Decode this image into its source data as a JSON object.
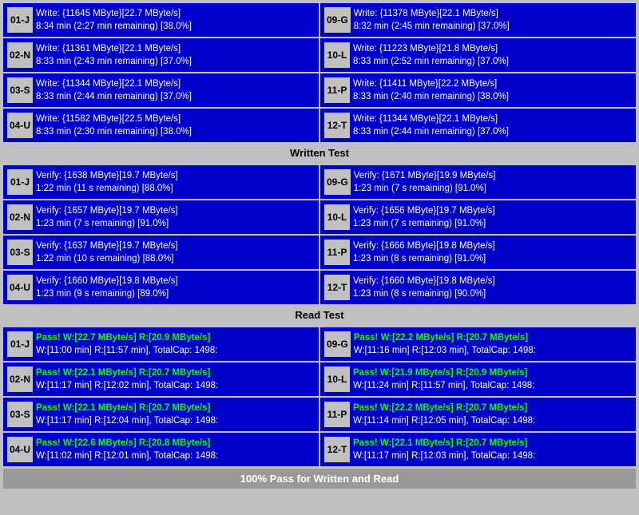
{
  "sections": {
    "write": {
      "rows": [
        {
          "left": {
            "id": "01-J",
            "line1": "Write: {11645 MByte}[22.7 MByte/s]",
            "line2": "8:34 min (2:27 min remaining)  [38.0%]"
          },
          "right": {
            "id": "09-G",
            "line1": "Write: {11378 MByte}[22.1 MByte/s]",
            "line2": "8:32 min (2:45 min remaining)  [37.0%]"
          }
        },
        {
          "left": {
            "id": "02-N",
            "line1": "Write: {11361 MByte}[22.1 MByte/s]",
            "line2": "8:33 min (2:43 min remaining)  [37.0%]"
          },
          "right": {
            "id": "10-L",
            "line1": "Write: {11223 MByte}[21.8 MByte/s]",
            "line2": "8:33 min (2:52 min remaining)  [37.0%]"
          }
        },
        {
          "left": {
            "id": "03-S",
            "line1": "Write: {11344 MByte}[22.1 MByte/s]",
            "line2": "8:33 min (2:44 min remaining)  [37.0%]"
          },
          "right": {
            "id": "11-P",
            "line1": "Write: {11411 MByte}[22.2 MByte/s]",
            "line2": "8:33 min (2:40 min remaining)  [38.0%]"
          }
        },
        {
          "left": {
            "id": "04-U",
            "line1": "Write: {11582 MByte}[22.5 MByte/s]",
            "line2": "8:33 min (2:30 min remaining)  [38.0%]"
          },
          "right": {
            "id": "12-T",
            "line1": "Write: {11344 MByte}[22.1 MByte/s]",
            "line2": "8:33 min (2:44 min remaining)  [37.0%]"
          }
        }
      ],
      "header": "Written Test"
    },
    "verify": {
      "rows": [
        {
          "left": {
            "id": "01-J",
            "line1": "Verify: {1638 MByte}[19.7 MByte/s]",
            "line2": "1:22 min (11 s remaining)   [88.0%]"
          },
          "right": {
            "id": "09-G",
            "line1": "Verify: {1671 MByte}[19.9 MByte/s]",
            "line2": "1:23 min (7 s remaining)   [91.0%]"
          }
        },
        {
          "left": {
            "id": "02-N",
            "line1": "Verify: {1657 MByte}[19.7 MByte/s]",
            "line2": "1:23 min (7 s remaining)   [91.0%]"
          },
          "right": {
            "id": "10-L",
            "line1": "Verify: {1656 MByte}[19.7 MByte/s]",
            "line2": "1:23 min (7 s remaining)   [91.0%]"
          }
        },
        {
          "left": {
            "id": "03-S",
            "line1": "Verify: {1637 MByte}[19.7 MByte/s]",
            "line2": "1:22 min (10 s remaining)   [88.0%]"
          },
          "right": {
            "id": "11-P",
            "line1": "Verify: {1666 MByte}[19.8 MByte/s]",
            "line2": "1:23 min (8 s remaining)   [91.0%]"
          }
        },
        {
          "left": {
            "id": "04-U",
            "line1": "Verify: {1660 MByte}[19.8 MByte/s]",
            "line2": "1:23 min (9 s remaining)   [89.0%]"
          },
          "right": {
            "id": "12-T",
            "line1": "Verify: {1660 MByte}[19.8 MByte/s]",
            "line2": "1:23 min (8 s remaining)   [90.0%]"
          }
        }
      ],
      "header": "Read Test"
    },
    "results": {
      "rows": [
        {
          "left": {
            "id": "01-J",
            "line1": "Pass! W:[22.7 MByte/s] R:[20.9 MByte/s]",
            "line2": "W:[11:00 min] R:[11:57 min], TotalCap: 1498:"
          },
          "right": {
            "id": "09-G",
            "line1": "Pass! W:[22.2 MByte/s] R:[20.7 MByte/s]",
            "line2": "W:[11:16 min] R:[12:03 min], TotalCap: 1498:"
          }
        },
        {
          "left": {
            "id": "02-N",
            "line1": "Pass! W:[22.1 MByte/s] R:[20.7 MByte/s]",
            "line2": "W:[11:17 min] R:[12:02 min], TotalCap: 1498:"
          },
          "right": {
            "id": "10-L",
            "line1": "Pass! W:[21.9 MByte/s] R:[20.9 MByte/s]",
            "line2": "W:[11:24 min] R:[11:57 min], TotalCap: 1498:"
          }
        },
        {
          "left": {
            "id": "03-S",
            "line1": "Pass! W:[22.1 MByte/s] R:[20.7 MByte/s]",
            "line2": "W:[11:17 min] R:[12:04 min], TotalCap: 1498:"
          },
          "right": {
            "id": "11-P",
            "line1": "Pass! W:[22.2 MByte/s] R:[20.7 MByte/s]",
            "line2": "W:[11:14 min] R:[12:05 min], TotalCap: 1498:"
          }
        },
        {
          "left": {
            "id": "04-U",
            "line1": "Pass! W:[22.6 MByte/s] R:[20.8 MByte/s]",
            "line2": "W:[11:02 min] R:[12:01 min], TotalCap: 1498:"
          },
          "right": {
            "id": "12-T",
            "line1": "Pass! W:[22.1 MByte/s] R:[20.7 MByte/s]",
            "line2": "W:[11:17 min] R:[12:03 min], TotalCap: 1498:"
          }
        }
      ]
    }
  },
  "footer": "100% Pass for Written and Read"
}
